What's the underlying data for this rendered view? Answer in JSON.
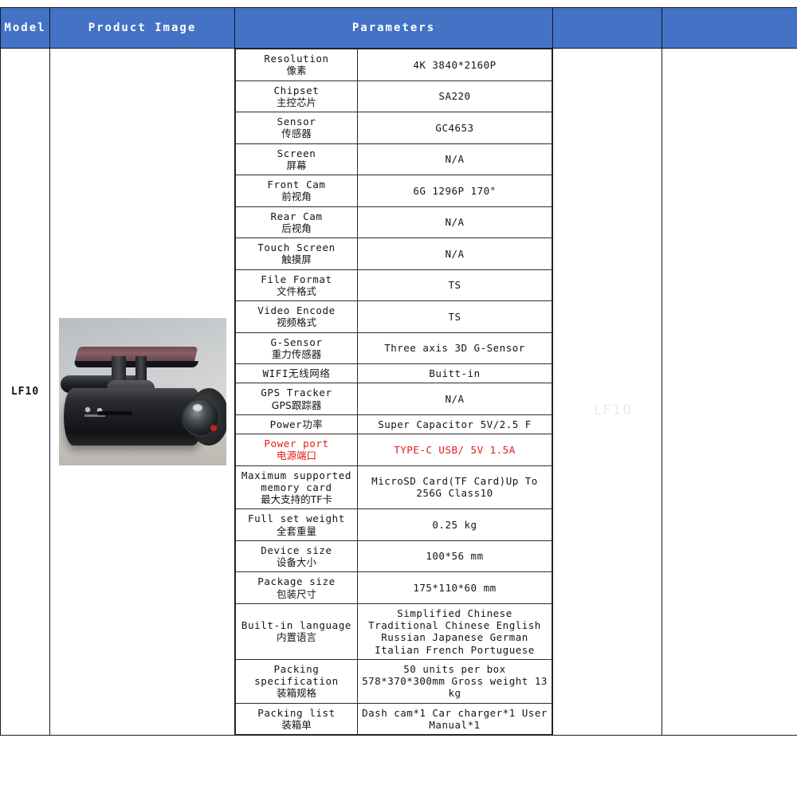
{
  "table": {
    "headers": [
      {
        "label": "Model"
      },
      {
        "label": "Product Image"
      },
      {
        "label": "Parameters"
      },
      {
        "label": ""
      }
    ],
    "model": "LF10",
    "product_image": {
      "alt": "black cylindrical dash camera with adhesive mount",
      "icon": "dashcam-photo"
    },
    "watermark": "LF10",
    "parameters": [
      {
        "key_en": "Resolution",
        "key_cn": "像素",
        "value": "4K   3840*2160P",
        "highlight": false
      },
      {
        "key_en": "Chipset",
        "key_cn": "主控芯片",
        "value": "SA220",
        "highlight": false
      },
      {
        "key_en": "Sensor",
        "key_cn": "传感器",
        "value": "GC4653",
        "highlight": false
      },
      {
        "key_en": "Screen",
        "key_cn": "屏幕",
        "value": "N/A",
        "highlight": false
      },
      {
        "key_en": "Front Cam",
        "key_cn": "前视角",
        "value": "6G 1296P 170°",
        "highlight": false
      },
      {
        "key_en": "Rear Cam",
        "key_cn": "后视角",
        "value": "N/A",
        "highlight": false
      },
      {
        "key_en": "Touch Screen",
        "key_cn": "触摸屏",
        "value": "N/A",
        "highlight": false
      },
      {
        "key_en": "File Format",
        "key_cn": "文件格式",
        "value": "TS",
        "highlight": false
      },
      {
        "key_en": "Video Encode",
        "key_cn": "视频格式",
        "value": "TS",
        "highlight": false
      },
      {
        "key_en": "G-Sensor",
        "key_cn": "重力传感器",
        "value": "Three axis 3D G-Sensor",
        "highlight": false
      },
      {
        "key_en": "WIFI无线网络",
        "key_cn": "",
        "value": "Buitt-in",
        "highlight": false
      },
      {
        "key_en": "GPS Tracker",
        "key_cn": "GPS跟踪器",
        "value": "N/A",
        "highlight": false
      },
      {
        "key_en": "Power功率",
        "key_cn": "",
        "value": "Super Capacitor  5V/2.5 F",
        "highlight": false
      },
      {
        "key_en": "Power port",
        "key_cn": "电源端口",
        "value": "TYPE-C USB/ 5V 1.5A",
        "highlight": true
      },
      {
        "key_en": "Maximum supported\nmemory card",
        "key_cn": "最大支持的TF卡",
        "value": "MicroSD Card(TF Card)Up To 256G Class10",
        "highlight": false
      },
      {
        "key_en": "Full set weight",
        "key_cn": "全套重量",
        "value": "0.25 kg",
        "highlight": false
      },
      {
        "key_en": "Device size",
        "key_cn": "设备大小",
        "value": "100*56 mm",
        "highlight": false
      },
      {
        "key_en": "Package size",
        "key_cn": "包装尺寸",
        "value": "175*110*60 mm",
        "highlight": false
      },
      {
        "key_en": "Built-in language",
        "key_cn": "内置语言",
        "value": "Simplified Chinese Traditional Chinese English Russian Japanese German Italian French Portuguese",
        "highlight": false
      },
      {
        "key_en": "Packing specification",
        "key_cn": "装箱规格",
        "value": "50 units per box    578*370*300mm Gross weight 13 kg",
        "highlight": false
      },
      {
        "key_en": "Packing list",
        "key_cn": "装箱单",
        "value": "Dash cam*1  Car charger*1  User Manual*1",
        "highlight": false
      }
    ]
  },
  "colors": {
    "header_blue": "#4472C4",
    "header_text": "#FFFFFF",
    "highlight_red": "#E01B1B",
    "border": "#2B2B2B"
  }
}
